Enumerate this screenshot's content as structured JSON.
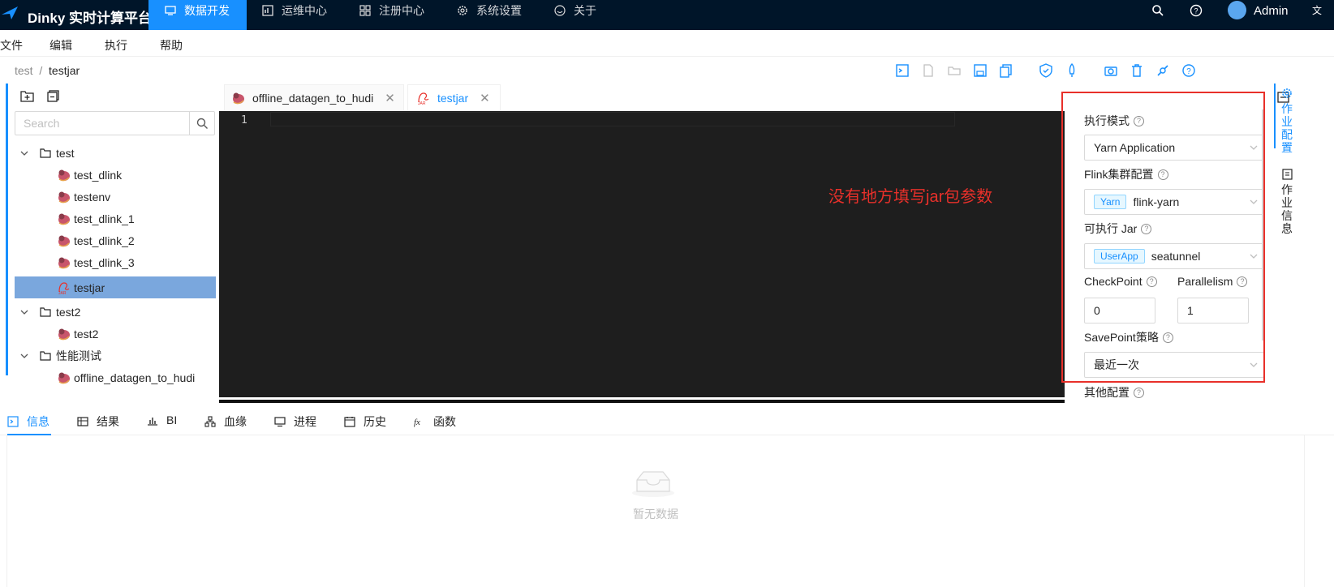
{
  "app": {
    "title": "Dinky 实时计算平台"
  },
  "nav": {
    "items": [
      {
        "label": "数据开发",
        "icon": "monitor-icon",
        "active": true
      },
      {
        "label": "运维中心",
        "icon": "dashboard-icon",
        "active": false
      },
      {
        "label": "注册中心",
        "icon": "grid-icon",
        "active": false
      },
      {
        "label": "系统设置",
        "icon": "gear-icon",
        "active": false
      },
      {
        "label": "关于",
        "icon": "smile-icon",
        "active": false
      }
    ],
    "user": "Admin",
    "accent": "#1890ff",
    "background": "#001529"
  },
  "menu": {
    "items": [
      "文件",
      "编辑",
      "执行",
      "帮助"
    ]
  },
  "breadcrumb": {
    "parent": "test",
    "separator": "/",
    "current": "testjar"
  },
  "toolbar": {
    "icons": [
      "console-icon",
      "new-file-icon",
      "open-folder-icon",
      "save-icon",
      "copy-icon",
      "shield-check-icon",
      "rocket-icon",
      "camera-icon",
      "trash-icon",
      "api-icon",
      "help-icon"
    ]
  },
  "tree": {
    "search_placeholder": "Search",
    "rows": [
      {
        "label": "test",
        "kind": "folder"
      },
      {
        "label": "test_dlink",
        "kind": "flink"
      },
      {
        "label": "testenv",
        "kind": "flink"
      },
      {
        "label": "test_dlink_1",
        "kind": "flink"
      },
      {
        "label": "test_dlink_2",
        "kind": "flink"
      },
      {
        "label": "test_dlink_3",
        "kind": "flink"
      },
      {
        "label": "testjar",
        "kind": "jar",
        "selected": true
      },
      {
        "label": "test2",
        "kind": "folder"
      },
      {
        "label": "test2",
        "kind": "flink"
      },
      {
        "label": "性能测试",
        "kind": "folder"
      },
      {
        "label": "offline_datagen_to_hudi",
        "kind": "flink"
      }
    ]
  },
  "editor": {
    "tabs": [
      {
        "label": "offline_datagen_to_hudi",
        "active": false
      },
      {
        "label": "testjar",
        "active": true
      }
    ],
    "line_number": "1",
    "annotation": "没有地方填写jar包参数",
    "annotation_color": "#e8302a"
  },
  "config": {
    "exec_mode_label": "执行模式",
    "exec_mode_value": "Yarn Application",
    "cluster_label": "Flink集群配置",
    "cluster_tag": "Yarn",
    "cluster_value": "flink-yarn",
    "jar_label": "可执行 Jar",
    "jar_tag": "UserApp",
    "jar_value": "seatunnel",
    "checkpoint_label": "CheckPoint",
    "checkpoint_value": "0",
    "parallelism_label": "Parallelism",
    "parallelism_value": "1",
    "savepoint_label": "SavePoint策略",
    "savepoint_value": "最近一次",
    "other_label": "其他配置"
  },
  "side_tabs": [
    "作业配置",
    "作业信息"
  ],
  "bottom": {
    "tabs": [
      {
        "label": "信息",
        "icon": "console-icon",
        "active": true
      },
      {
        "label": "结果",
        "icon": "table-icon",
        "active": false
      },
      {
        "label": "BI",
        "icon": "bar-chart-icon",
        "active": false
      },
      {
        "label": "血缘",
        "icon": "lineage-icon",
        "active": false
      },
      {
        "label": "进程",
        "icon": "desktop-icon",
        "active": false
      },
      {
        "label": "历史",
        "icon": "calendar-icon",
        "active": false
      },
      {
        "label": "函数",
        "icon": "function-icon",
        "active": false
      }
    ],
    "empty_text": "暂无数据"
  }
}
